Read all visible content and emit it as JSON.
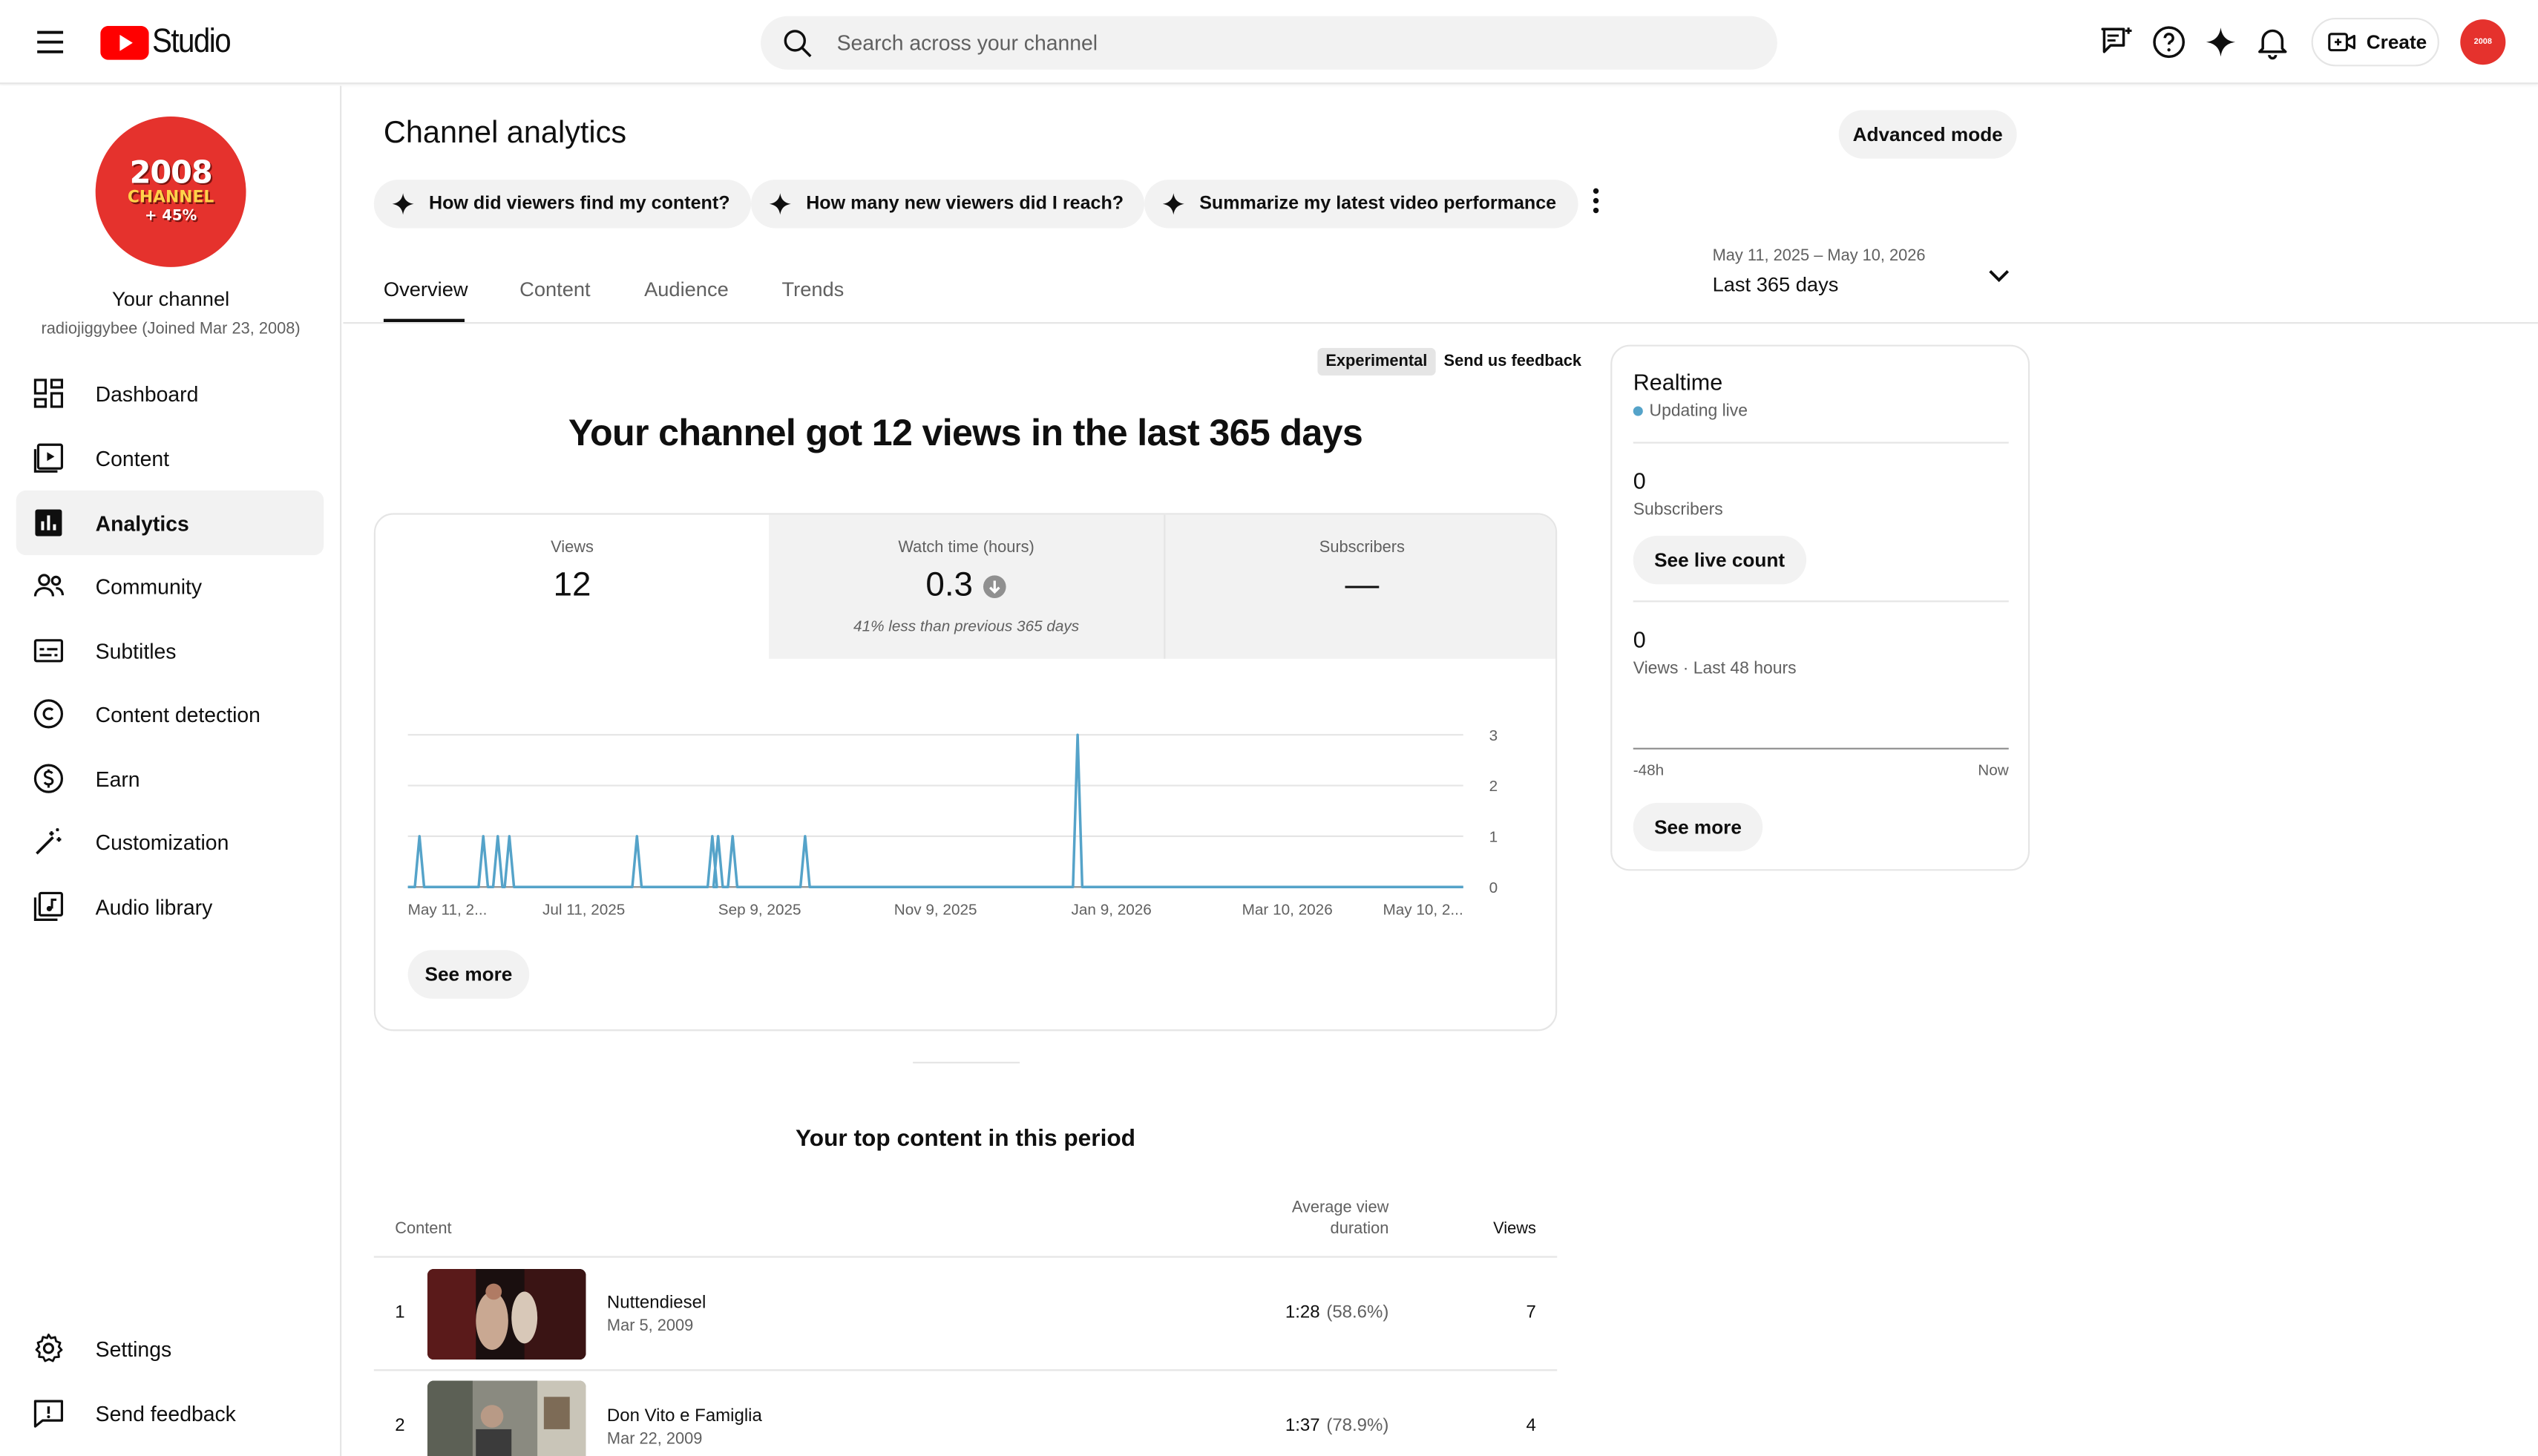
{
  "header": {
    "logo_text": "Studio",
    "search_placeholder": "Search across your channel",
    "create_label": "Create",
    "avatar_text": "2008"
  },
  "sidebar": {
    "channel_avatar": {
      "line1": "2008",
      "line2": "CHANNEL",
      "line3": "+ 45%"
    },
    "channel_name": "Your channel",
    "channel_sub": "radiojiggybee (Joined Mar 23, 2008)",
    "items": [
      {
        "label": "Dashboard",
        "icon": "dashboard-icon",
        "active": false
      },
      {
        "label": "Content",
        "icon": "content-icon",
        "active": false
      },
      {
        "label": "Analytics",
        "icon": "analytics-icon",
        "active": true
      },
      {
        "label": "Community",
        "icon": "community-icon",
        "active": false
      },
      {
        "label": "Subtitles",
        "icon": "subtitles-icon",
        "active": false
      },
      {
        "label": "Content detection",
        "icon": "copyright-icon",
        "active": false
      },
      {
        "label": "Earn",
        "icon": "dollar-icon",
        "active": false
      },
      {
        "label": "Customization",
        "icon": "magic-wand-icon",
        "active": false
      },
      {
        "label": "Audio library",
        "icon": "audio-library-icon",
        "active": false
      }
    ],
    "bottom_items": [
      {
        "label": "Settings",
        "icon": "gear-icon"
      },
      {
        "label": "Send feedback",
        "icon": "feedback-icon"
      }
    ]
  },
  "main": {
    "title": "Channel analytics",
    "advanced_mode": "Advanced mode",
    "chips": [
      "How did viewers find my content?",
      "How many new viewers did I reach?",
      "Summarize my latest video performance"
    ],
    "tabs": [
      "Overview",
      "Content",
      "Audience",
      "Trends"
    ],
    "date_range": {
      "dates": "May 11, 2025 – May 10, 2026",
      "label": "Last 365 days"
    },
    "experimental": "Experimental",
    "send_feedback": "Send us feedback",
    "headline": "Your channel got 12 views in the last 365 days",
    "metrics": [
      {
        "label": "Views",
        "value": "12",
        "note": ""
      },
      {
        "label": "Watch time (hours)",
        "value": "0.3",
        "note": "41% less than previous 365 days"
      },
      {
        "label": "Subscribers",
        "value": "—",
        "note": ""
      }
    ],
    "see_more": "See more",
    "top_content": {
      "title": "Your top content in this period",
      "col_content": "Content",
      "col_avg_line1": "Average view",
      "col_avg_line2": "duration",
      "col_views": "Views",
      "rows": [
        {
          "rank": "1",
          "title": "Nuttendiesel",
          "date": "Mar 5, 2009",
          "avg": "1:28",
          "pct": "(58.6%)",
          "views": "7"
        },
        {
          "rank": "2",
          "title": "Don Vito e Famiglia",
          "date": "Mar 22, 2009",
          "avg": "1:37",
          "pct": "(78.9%)",
          "views": "4"
        }
      ]
    }
  },
  "realtime": {
    "title": "Realtime",
    "status": "Updating live",
    "subs_value": "0",
    "subs_label": "Subscribers",
    "see_live_count": "See live count",
    "views_value": "0",
    "views_label": "Views · Last 48 hours",
    "axis_start": "-48h",
    "axis_end": "Now",
    "see_more": "See more"
  },
  "chart_data": {
    "type": "line",
    "title": "",
    "xlabel": "",
    "ylabel": "",
    "x_tick_labels": [
      "May 11, 2...",
      "Jul 11, 2025",
      "Sep 9, 2025",
      "Nov 9, 2025",
      "Jan 9, 2026",
      "Mar 10, 2026",
      "May 10, 2..."
    ],
    "y_ticks": [
      0,
      1,
      2,
      3
    ],
    "ylim": [
      0,
      3
    ],
    "x_range": [
      "2025-05-11",
      "2026-05-10"
    ],
    "series": [
      {
        "color": "#55a3c9",
        "points": [
          {
            "date": "2025-05-15",
            "views": 1
          },
          {
            "date": "2025-06-06",
            "views": 1
          },
          {
            "date": "2025-06-11",
            "views": 1
          },
          {
            "date": "2025-06-15",
            "views": 1
          },
          {
            "date": "2025-07-29",
            "views": 1
          },
          {
            "date": "2025-08-24",
            "views": 1
          },
          {
            "date": "2025-08-26",
            "views": 1
          },
          {
            "date": "2025-08-31",
            "views": 1
          },
          {
            "date": "2025-09-25",
            "views": 1
          },
          {
            "date": "2025-12-28",
            "views": 3
          }
        ]
      }
    ],
    "grid": true
  }
}
